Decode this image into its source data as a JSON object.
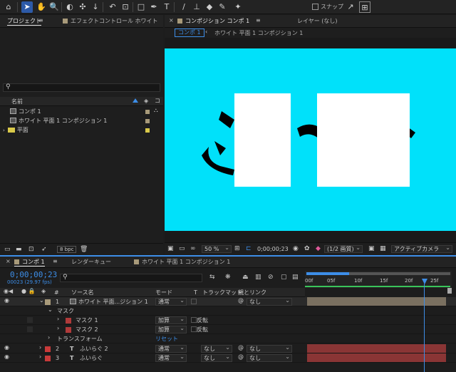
{
  "toolbar": {
    "snap_label": "スナップ",
    "tools": [
      "home-icon",
      "selection-icon",
      "hand-icon",
      "zoom-icon",
      "orbit-icon",
      "pan-icon",
      "dolly-icon",
      "rotate-icon",
      "camera-icon",
      "rectangle-icon",
      "pen-icon",
      "type-icon",
      "brush-icon",
      "stamp-icon",
      "eraser-icon",
      "roto-icon",
      "puppet-icon"
    ]
  },
  "project_panel": {
    "tab_project": "プロジェクト",
    "tab_effects": "エフェクトコントロール ホワイト",
    "search_placeholder": "",
    "col_name": "名前",
    "items": [
      {
        "name": "コンポ 1",
        "type": "comp"
      },
      {
        "name": "ホワイト 平面 1 コンポジション 1",
        "type": "comp"
      },
      {
        "name": "平面",
        "type": "folder"
      }
    ],
    "bpc": "8 bpc",
    "colors": {
      "folder": "#d9c94a",
      "comp_swatch": "#a89a7a"
    }
  },
  "viewer": {
    "tab_comp": "コンポジション コンポ 1",
    "tab_layer": "レイヤー (なし)",
    "breadcrumb_1": "コンポ 1",
    "breadcrumb_2": "ホワイト 平面 1 コンポジション 1",
    "canvas_color": "#00e1fa",
    "zoom": "50 %",
    "timecode": "0;00;00;23",
    "resolution": "(1/2 画質)",
    "camera": "アクティブカメラ"
  },
  "timeline": {
    "tab_comp": "コンポ 1",
    "tab_render": "レンダーキュー",
    "tab_white": "ホワイト 平面 1 コンポジション 1",
    "timecode": "0;00;00;23",
    "fps": "00023 (29.97 fps)",
    "search_placeholder": "",
    "col_num": "#",
    "col_source": "ソース名",
    "col_mode": "モード",
    "col_t": "T",
    "col_trackmatte": "トラックマット",
    "col_parent": "親とリンク",
    "ruler": [
      "00f",
      "05f",
      "10f",
      "15f",
      "20f",
      "25f"
    ],
    "rows": [
      {
        "num": "1",
        "name": "ホワイト 平面...ジション 1",
        "mode": "通常",
        "parent": "なし",
        "color": "#a89a7a",
        "bar": "#7a7060"
      },
      {
        "name": "マスク",
        "indent": 1
      },
      {
        "name": "マスク 1",
        "mode": "加算",
        "invert": "反転",
        "color": "#b03a3a"
      },
      {
        "name": "マスク 2",
        "mode": "加算",
        "invert": "反転",
        "color": "#b03a3a"
      },
      {
        "name": "トランスフォーム",
        "reset": "リセット"
      },
      {
        "num": "2",
        "name": "ふいらぐ 2",
        "mode": "通常",
        "matte": "なし",
        "parent": "なし",
        "color": "#c83a3a",
        "bar": "#8a3535"
      },
      {
        "num": "3",
        "name": "ふいらぐ",
        "mode": "通常",
        "matte": "なし",
        "parent": "なし",
        "color": "#c83a3a",
        "bar": "#8a3535"
      }
    ],
    "playhead_frame": 23
  }
}
